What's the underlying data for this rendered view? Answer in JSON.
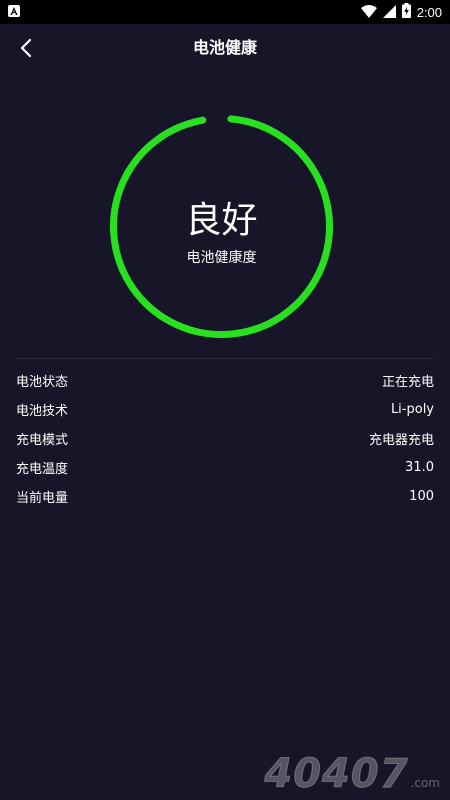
{
  "status_bar": {
    "time": "2:00",
    "icons": [
      "notification-icon",
      "wifi-icon",
      "signal-icon",
      "battery-charging-icon"
    ]
  },
  "header": {
    "title": "电池健康",
    "back_icon": "back-chevron-icon"
  },
  "health": {
    "status": "良好",
    "label": "电池健康度",
    "ring_color": "#28e020"
  },
  "info": [
    {
      "label": "电池状态",
      "value": "正在充电"
    },
    {
      "label": "电池技术",
      "value": "Li-poly"
    },
    {
      "label": "充电模式",
      "value": "充电器充电"
    },
    {
      "label": "充电温度",
      "value": "31.0"
    },
    {
      "label": "当前电量",
      "value": "100"
    }
  ],
  "watermark": {
    "digits": "40407",
    "suffix": ".com"
  },
  "colors": {
    "background": "#161628",
    "status_bar": "#000000",
    "text": "#ffffff",
    "divider": "#2c2c44"
  }
}
